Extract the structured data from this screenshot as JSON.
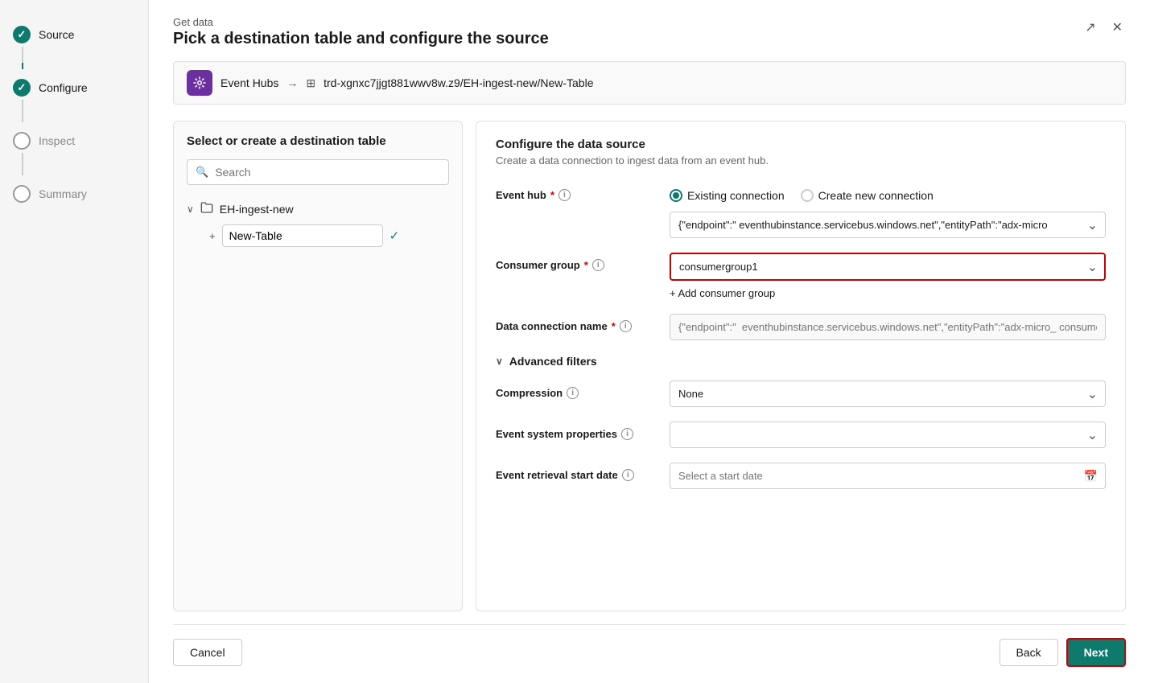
{
  "sidebar": {
    "items": [
      {
        "label": "Source",
        "state": "completed"
      },
      {
        "label": "Configure",
        "state": "active"
      },
      {
        "label": "Inspect",
        "state": "inactive"
      },
      {
        "label": "Summary",
        "state": "inactive"
      }
    ]
  },
  "header": {
    "get_data_label": "Get data",
    "page_title": "Pick a destination table and configure the source"
  },
  "breadcrumb": {
    "event_hub_label": "Event Hubs",
    "destination_path": "trd-xgnxc7jjgt881wwv8w.z9/EH-ingest-new/New-Table"
  },
  "left_panel": {
    "title": "Select or create a destination table",
    "search_placeholder": "Search",
    "tree": {
      "folder_name": "EH-ingest-new",
      "table_name": "New-Table"
    }
  },
  "right_panel": {
    "title": "Configure the data source",
    "subtitle": "Create a data connection to ingest data from an event hub.",
    "event_hub_label": "Event hub",
    "existing_connection_label": "Existing connection",
    "create_connection_label": "Create new connection",
    "connection_value": "{\"endpoint\":\"  eventhubinstance.servicebus.windows.net\",\"entityPath\":\"adx-micro",
    "consumer_group_label": "Consumer group",
    "consumer_group_value": "consumergroup1",
    "add_consumer_group_label": "+ Add consumer group",
    "data_connection_name_label": "Data connection name",
    "data_connection_name_placeholder": "{\"endpoint\":\"  eventhubinstance.servicebus.windows.net\",\"entityPath\":\"adx-micro_ consume",
    "advanced_filters_label": "Advanced filters",
    "compression_label": "Compression",
    "compression_value": "None",
    "event_system_properties_label": "Event system properties",
    "event_retrieval_start_date_label": "Event retrieval start date",
    "event_retrieval_placeholder": "Select a start date"
  },
  "footer": {
    "cancel_label": "Cancel",
    "back_label": "Back",
    "next_label": "Next"
  },
  "icons": {
    "search": "🔍",
    "event_hub": "⚡",
    "folder": "📁",
    "calendar": "📅",
    "expand_arrow": "↗",
    "close": "✕",
    "arrow_right": "→",
    "table_grid": "⊞",
    "chevron_down": "∨",
    "chevron_right": "›",
    "info": "i",
    "plus": "+"
  }
}
